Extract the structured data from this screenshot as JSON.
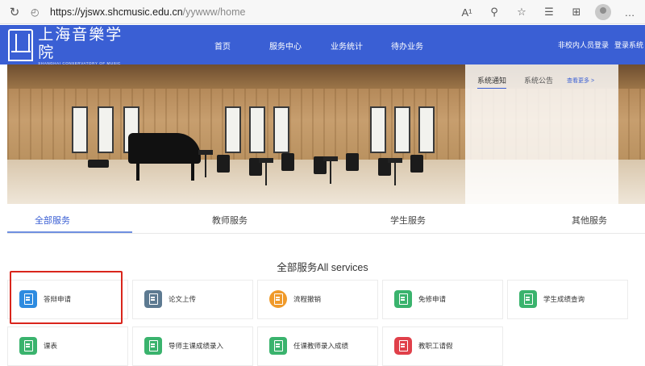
{
  "browser": {
    "url_host": "https://yjswx.shcmusic.edu.cn",
    "url_path": "/yywww/home",
    "icons": [
      "reload-icon",
      "lock-icon",
      "read-aloud-icon",
      "zoom-icon",
      "favorite-icon",
      "favorites-list-icon",
      "collections-icon",
      "profile-icon",
      "more-icon"
    ],
    "read_aloud": "A¹",
    "more": "…"
  },
  "header": {
    "logo_cn": "上海音樂学院",
    "logo_en": "SHANGHAI CONSERVATORY OF MUSIC",
    "nav": [
      "首页",
      "服务中心",
      "业务统计",
      "待办业务"
    ],
    "right_links": [
      "非校内人员登录",
      "登录系统"
    ],
    "bg_color": "#3a5fd4"
  },
  "banner": {
    "notice_tabs": [
      "系统通知",
      "系统公告"
    ],
    "more_link": "查看更多 >"
  },
  "service_tabs": [
    "全部服务",
    "教师服务",
    "学生服务",
    "其他服务"
  ],
  "section_title": "全部服务All services",
  "services": [
    {
      "label": "答辩申请",
      "color": "#2d8be0",
      "icon": "document-upload-icon"
    },
    {
      "label": "论文上传",
      "color": "#5d7a91",
      "icon": "cloud-upload-icon"
    },
    {
      "label": "流程撤销",
      "color": "#f09a2a",
      "icon": "revoke-icon"
    },
    {
      "label": "免修申请",
      "color": "#3ab36d",
      "icon": "form-icon"
    },
    {
      "label": "学生成绩查询",
      "color": "#3ab36d",
      "icon": "form-icon"
    },
    {
      "label": "课表",
      "color": "#3ab36d",
      "icon": "form-icon"
    },
    {
      "label": "导师主课成绩录入",
      "color": "#3ab36d",
      "icon": "form-icon"
    },
    {
      "label": "任课教师录入成绩",
      "color": "#3ab36d",
      "icon": "form-icon"
    },
    {
      "label": "教职工请假",
      "color": "#e0404a",
      "icon": "people-icon"
    }
  ]
}
